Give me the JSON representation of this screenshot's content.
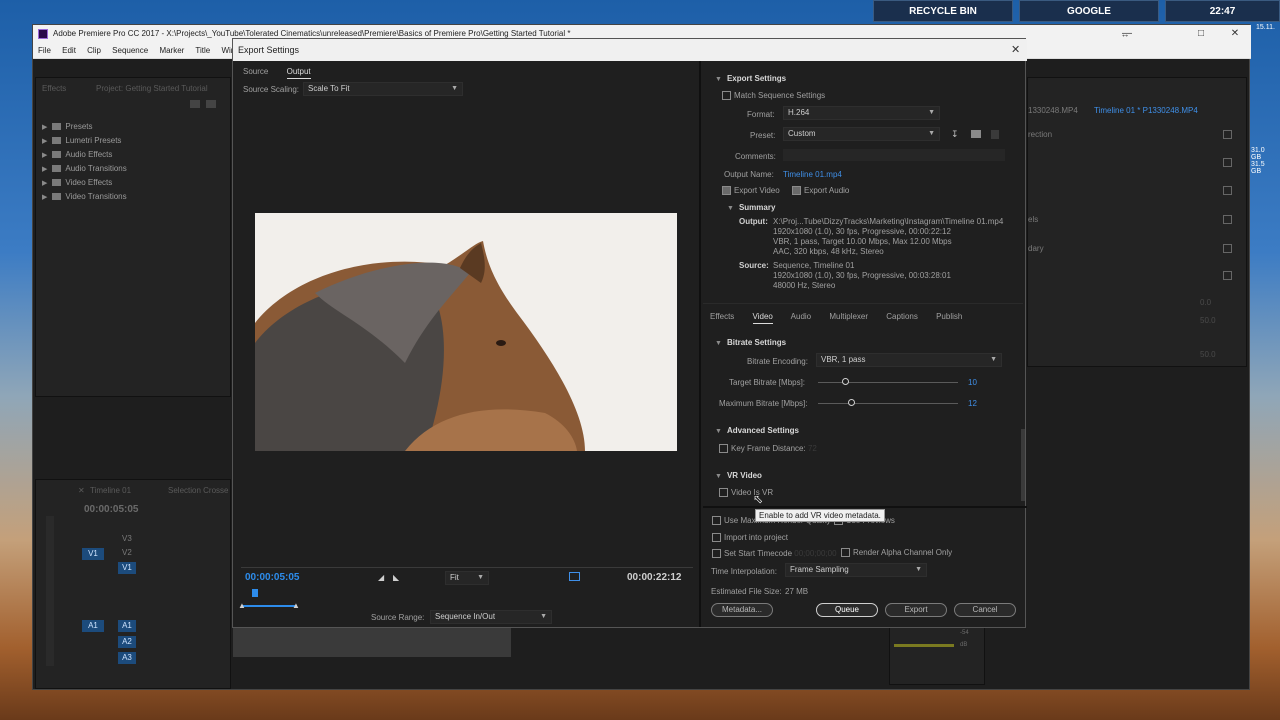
{
  "taskbar": {
    "recycle_bin": "RECYCLE BIN",
    "google": "GOOGLE",
    "time": "22:47",
    "date_fragment": "15.11."
  },
  "premiere": {
    "title": "Adobe Premiere Pro CC 2017 - X:\\Projects\\_YouTube\\Tolerated Cinematics\\unreleased\\Premiere\\Basics of Premiere Pro\\Getting Started Tutorial *",
    "menu": [
      "File",
      "Edit",
      "Clip",
      "Sequence",
      "Marker",
      "Title",
      "Wind"
    ],
    "effects_tab": "Effects",
    "project_tab": "Project: Getting Started Tutorial",
    "tree": [
      "Presets",
      "Lumetri Presets",
      "Audio Effects",
      "Audio Transitions",
      "Video Effects",
      "Video Transitions"
    ],
    "timeline_tab": "Timeline 01",
    "selection_tab": "Selection Crosse",
    "timecode": "00:00:05:05",
    "tracks_video": [
      "V3",
      "V2",
      "V1"
    ],
    "tracks_audio": [
      "A1",
      "A2",
      "A3"
    ],
    "track_src_v1": "V1",
    "track_src_a1": "A1",
    "right_tab": "Timeline 01 * P1330248.MP4",
    "right_clip": "1330248.MP4",
    "right_items": [
      "rection",
      "els",
      "dary"
    ],
    "disk": [
      "31.0 GB",
      "31.5 GB"
    ],
    "right_vals": [
      "0.0",
      "50.0",
      "50.0"
    ],
    "meter_labels": [
      "-54",
      "dB"
    ]
  },
  "dialog": {
    "title": "Export Settings",
    "tabs": [
      "Source",
      "Output"
    ],
    "source_scaling_label": "Source Scaling:",
    "source_scaling_value": "Scale To Fit",
    "current_time": "00:00:05:05",
    "fit": "Fit",
    "duration": "00:00:22:12",
    "source_range_label": "Source Range:",
    "source_range_value": "Sequence In/Out",
    "export_settings_header": "Export Settings",
    "match_sequence": "Match Sequence Settings",
    "format_label": "Format:",
    "format_value": "H.264",
    "preset_label": "Preset:",
    "preset_value": "Custom",
    "comments_label": "Comments:",
    "output_name_label": "Output Name:",
    "output_name_value": "Timeline 01.mp4",
    "export_video": "Export Video",
    "export_audio": "Export Audio",
    "summary_header": "Summary",
    "output_label": "Output:",
    "output_lines": [
      "X:\\Proj...Tube\\DizzyTracks\\Marketing\\Instagram\\Timeline 01.mp4",
      "1920x1080 (1.0), 30 fps, Progressive, 00:00:22:12",
      "VBR, 1 pass, Target 10.00 Mbps, Max 12.00 Mbps",
      "AAC, 320 kbps, 48 kHz, Stereo"
    ],
    "source_label": "Source:",
    "source_lines": [
      "Sequence, Timeline 01",
      "1920x1080 (1.0), 30 fps, Progressive, 00:03:28:01",
      "48000 Hz, Stereo"
    ],
    "sub_tabs": [
      "Effects",
      "Video",
      "Audio",
      "Multiplexer",
      "Captions",
      "Publish"
    ],
    "bitrate_header": "Bitrate Settings",
    "bitrate_encoding_label": "Bitrate Encoding:",
    "bitrate_encoding_value": "VBR, 1 pass",
    "target_bitrate_label": "Target Bitrate [Mbps]:",
    "target_bitrate_value": "10",
    "max_bitrate_label": "Maximum Bitrate [Mbps]:",
    "max_bitrate_value": "12",
    "advanced_header": "Advanced Settings",
    "key_frame_label": "Key Frame Distance:",
    "key_frame_value": "72",
    "vr_header": "VR Video",
    "video_is_vr": "Video Is VR",
    "tooltip": "Enable to add VR video metadata.",
    "use_max_render": "Use Maximum Render Quality",
    "use_previews": "Use Previews",
    "import_into_project": "Import into project",
    "set_start_timecode": "Set Start Timecode",
    "start_timecode_value": "00;00;00;00",
    "render_alpha": "Render Alpha Channel Only",
    "time_interp_label": "Time Interpolation:",
    "time_interp_value": "Frame Sampling",
    "file_size_label": "Estimated File Size:",
    "file_size_value": "27 MB",
    "metadata_btn": "Metadata...",
    "queue_btn": "Queue",
    "export_btn": "Export",
    "cancel_btn": "Cancel"
  },
  "colors": {
    "accent_blue": "#3f8fe8",
    "timecode_blue": "#2d8ceb",
    "dialog_bg": "#1f1f1f"
  }
}
